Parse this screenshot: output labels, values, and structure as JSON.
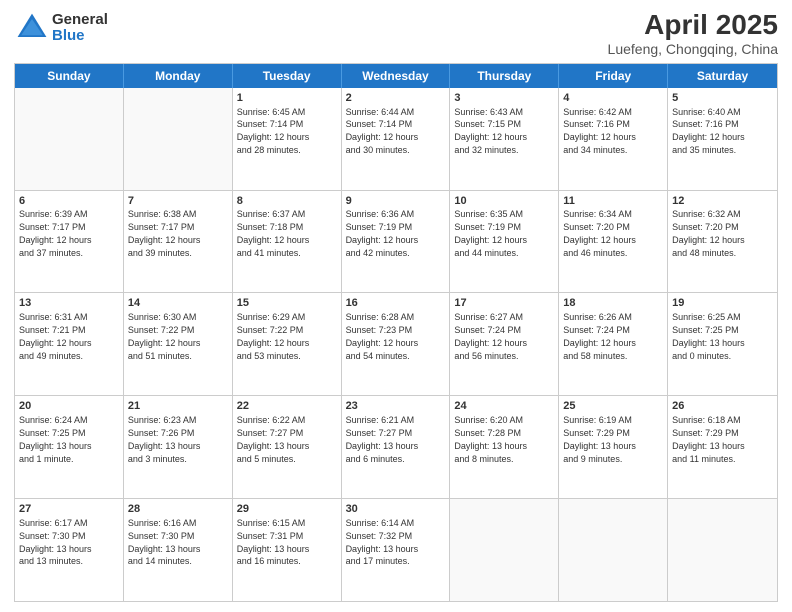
{
  "logo": {
    "general": "General",
    "blue": "Blue"
  },
  "title": "April 2025",
  "subtitle": "Luefeng, Chongqing, China",
  "header_days": [
    "Sunday",
    "Monday",
    "Tuesday",
    "Wednesday",
    "Thursday",
    "Friday",
    "Saturday"
  ],
  "weeks": [
    [
      {
        "day": "",
        "text": ""
      },
      {
        "day": "",
        "text": ""
      },
      {
        "day": "1",
        "text": "Sunrise: 6:45 AM\nSunset: 7:14 PM\nDaylight: 12 hours\nand 28 minutes."
      },
      {
        "day": "2",
        "text": "Sunrise: 6:44 AM\nSunset: 7:14 PM\nDaylight: 12 hours\nand 30 minutes."
      },
      {
        "day": "3",
        "text": "Sunrise: 6:43 AM\nSunset: 7:15 PM\nDaylight: 12 hours\nand 32 minutes."
      },
      {
        "day": "4",
        "text": "Sunrise: 6:42 AM\nSunset: 7:16 PM\nDaylight: 12 hours\nand 34 minutes."
      },
      {
        "day": "5",
        "text": "Sunrise: 6:40 AM\nSunset: 7:16 PM\nDaylight: 12 hours\nand 35 minutes."
      }
    ],
    [
      {
        "day": "6",
        "text": "Sunrise: 6:39 AM\nSunset: 7:17 PM\nDaylight: 12 hours\nand 37 minutes."
      },
      {
        "day": "7",
        "text": "Sunrise: 6:38 AM\nSunset: 7:17 PM\nDaylight: 12 hours\nand 39 minutes."
      },
      {
        "day": "8",
        "text": "Sunrise: 6:37 AM\nSunset: 7:18 PM\nDaylight: 12 hours\nand 41 minutes."
      },
      {
        "day": "9",
        "text": "Sunrise: 6:36 AM\nSunset: 7:19 PM\nDaylight: 12 hours\nand 42 minutes."
      },
      {
        "day": "10",
        "text": "Sunrise: 6:35 AM\nSunset: 7:19 PM\nDaylight: 12 hours\nand 44 minutes."
      },
      {
        "day": "11",
        "text": "Sunrise: 6:34 AM\nSunset: 7:20 PM\nDaylight: 12 hours\nand 46 minutes."
      },
      {
        "day": "12",
        "text": "Sunrise: 6:32 AM\nSunset: 7:20 PM\nDaylight: 12 hours\nand 48 minutes."
      }
    ],
    [
      {
        "day": "13",
        "text": "Sunrise: 6:31 AM\nSunset: 7:21 PM\nDaylight: 12 hours\nand 49 minutes."
      },
      {
        "day": "14",
        "text": "Sunrise: 6:30 AM\nSunset: 7:22 PM\nDaylight: 12 hours\nand 51 minutes."
      },
      {
        "day": "15",
        "text": "Sunrise: 6:29 AM\nSunset: 7:22 PM\nDaylight: 12 hours\nand 53 minutes."
      },
      {
        "day": "16",
        "text": "Sunrise: 6:28 AM\nSunset: 7:23 PM\nDaylight: 12 hours\nand 54 minutes."
      },
      {
        "day": "17",
        "text": "Sunrise: 6:27 AM\nSunset: 7:24 PM\nDaylight: 12 hours\nand 56 minutes."
      },
      {
        "day": "18",
        "text": "Sunrise: 6:26 AM\nSunset: 7:24 PM\nDaylight: 12 hours\nand 58 minutes."
      },
      {
        "day": "19",
        "text": "Sunrise: 6:25 AM\nSunset: 7:25 PM\nDaylight: 13 hours\nand 0 minutes."
      }
    ],
    [
      {
        "day": "20",
        "text": "Sunrise: 6:24 AM\nSunset: 7:25 PM\nDaylight: 13 hours\nand 1 minute."
      },
      {
        "day": "21",
        "text": "Sunrise: 6:23 AM\nSunset: 7:26 PM\nDaylight: 13 hours\nand 3 minutes."
      },
      {
        "day": "22",
        "text": "Sunrise: 6:22 AM\nSunset: 7:27 PM\nDaylight: 13 hours\nand 5 minutes."
      },
      {
        "day": "23",
        "text": "Sunrise: 6:21 AM\nSunset: 7:27 PM\nDaylight: 13 hours\nand 6 minutes."
      },
      {
        "day": "24",
        "text": "Sunrise: 6:20 AM\nSunset: 7:28 PM\nDaylight: 13 hours\nand 8 minutes."
      },
      {
        "day": "25",
        "text": "Sunrise: 6:19 AM\nSunset: 7:29 PM\nDaylight: 13 hours\nand 9 minutes."
      },
      {
        "day": "26",
        "text": "Sunrise: 6:18 AM\nSunset: 7:29 PM\nDaylight: 13 hours\nand 11 minutes."
      }
    ],
    [
      {
        "day": "27",
        "text": "Sunrise: 6:17 AM\nSunset: 7:30 PM\nDaylight: 13 hours\nand 13 minutes."
      },
      {
        "day": "28",
        "text": "Sunrise: 6:16 AM\nSunset: 7:30 PM\nDaylight: 13 hours\nand 14 minutes."
      },
      {
        "day": "29",
        "text": "Sunrise: 6:15 AM\nSunset: 7:31 PM\nDaylight: 13 hours\nand 16 minutes."
      },
      {
        "day": "30",
        "text": "Sunrise: 6:14 AM\nSunset: 7:32 PM\nDaylight: 13 hours\nand 17 minutes."
      },
      {
        "day": "",
        "text": ""
      },
      {
        "day": "",
        "text": ""
      },
      {
        "day": "",
        "text": ""
      }
    ]
  ]
}
